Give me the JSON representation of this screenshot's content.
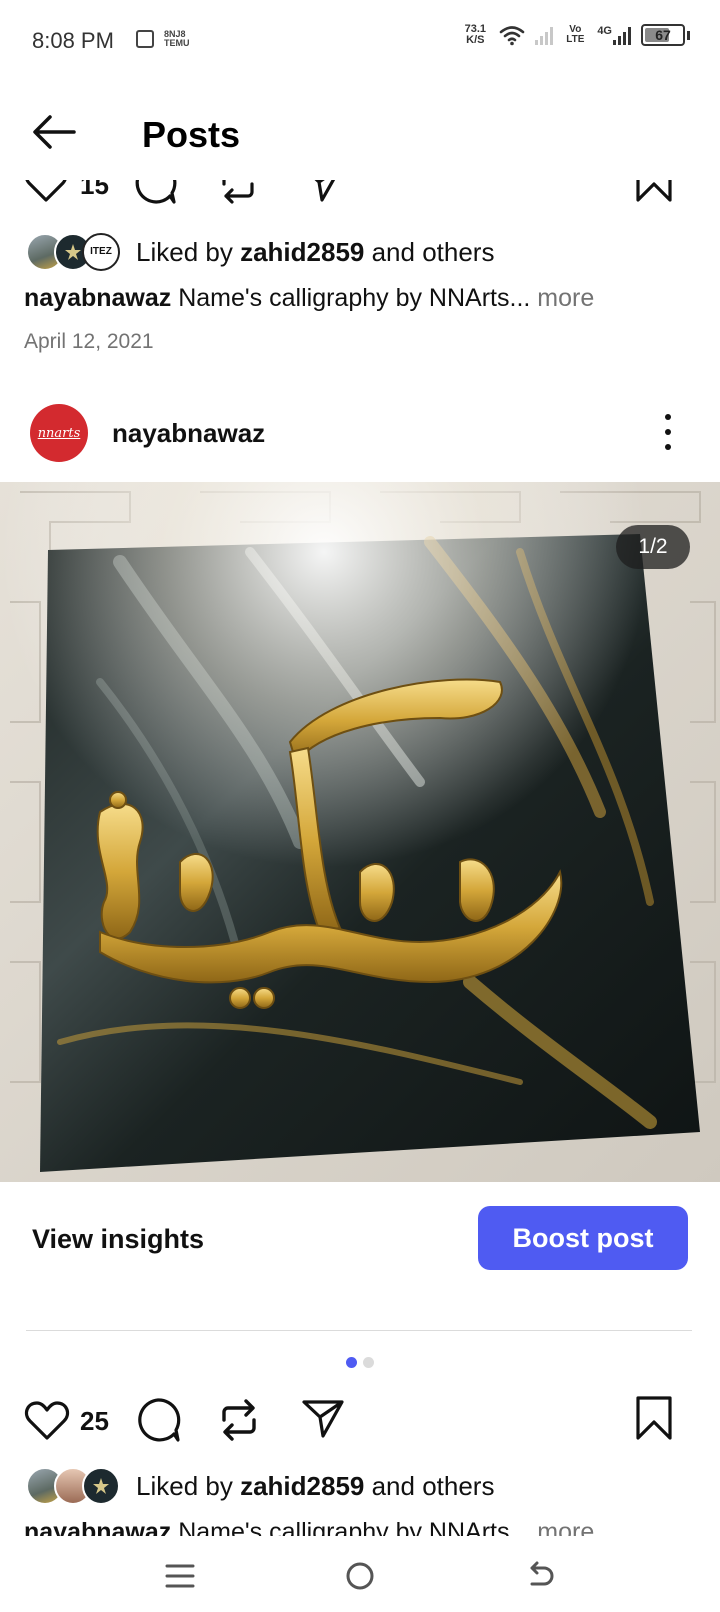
{
  "status_bar": {
    "time": "8:08 PM",
    "notif_text": "8NJ8 TEMU",
    "net_speed_value": "73.1",
    "net_speed_unit": "K/S",
    "volte_top": "Vo",
    "volte_bottom": "LTE",
    "network": "4G",
    "battery": "67",
    "battery_level": 0.67
  },
  "header": {
    "title": "Posts",
    "back_icon": "arrow-left-icon"
  },
  "previous_post": {
    "like_count_partial": "15",
    "liked_by_prefix": "Liked by ",
    "liked_by_user": "zahid2859",
    "liked_by_suffix": " and others",
    "caption_user": "nayabnawaz",
    "caption_text": " Name's calligraphy by NNArts",
    "caption_ellipsis": "...",
    "caption_more": " more",
    "date": "April 12, 2021"
  },
  "post": {
    "username": "nayabnawaz",
    "avatar_text": "nnarts",
    "page_indicator": "1/2",
    "view_insights": "View insights",
    "boost_button": "Boost post",
    "like_count": "25",
    "liked_by_prefix": "Liked by ",
    "liked_by_user": "zahid2859",
    "liked_by_suffix": " and others",
    "caption_user": "nayabnawaz",
    "caption_text": " Name's calligraphy by NNArts",
    "caption_ellipsis": "...",
    "caption_more": " more",
    "carousel_total": 2,
    "carousel_active": 1
  },
  "colors": {
    "accent": "#4f5bf2",
    "avatar_red": "#d32a2f",
    "muted_text": "#737373",
    "gold": "#d4a73a"
  },
  "nav_bar": {
    "icons": [
      "menu-icon",
      "home-circle-icon",
      "back-return-icon"
    ]
  }
}
